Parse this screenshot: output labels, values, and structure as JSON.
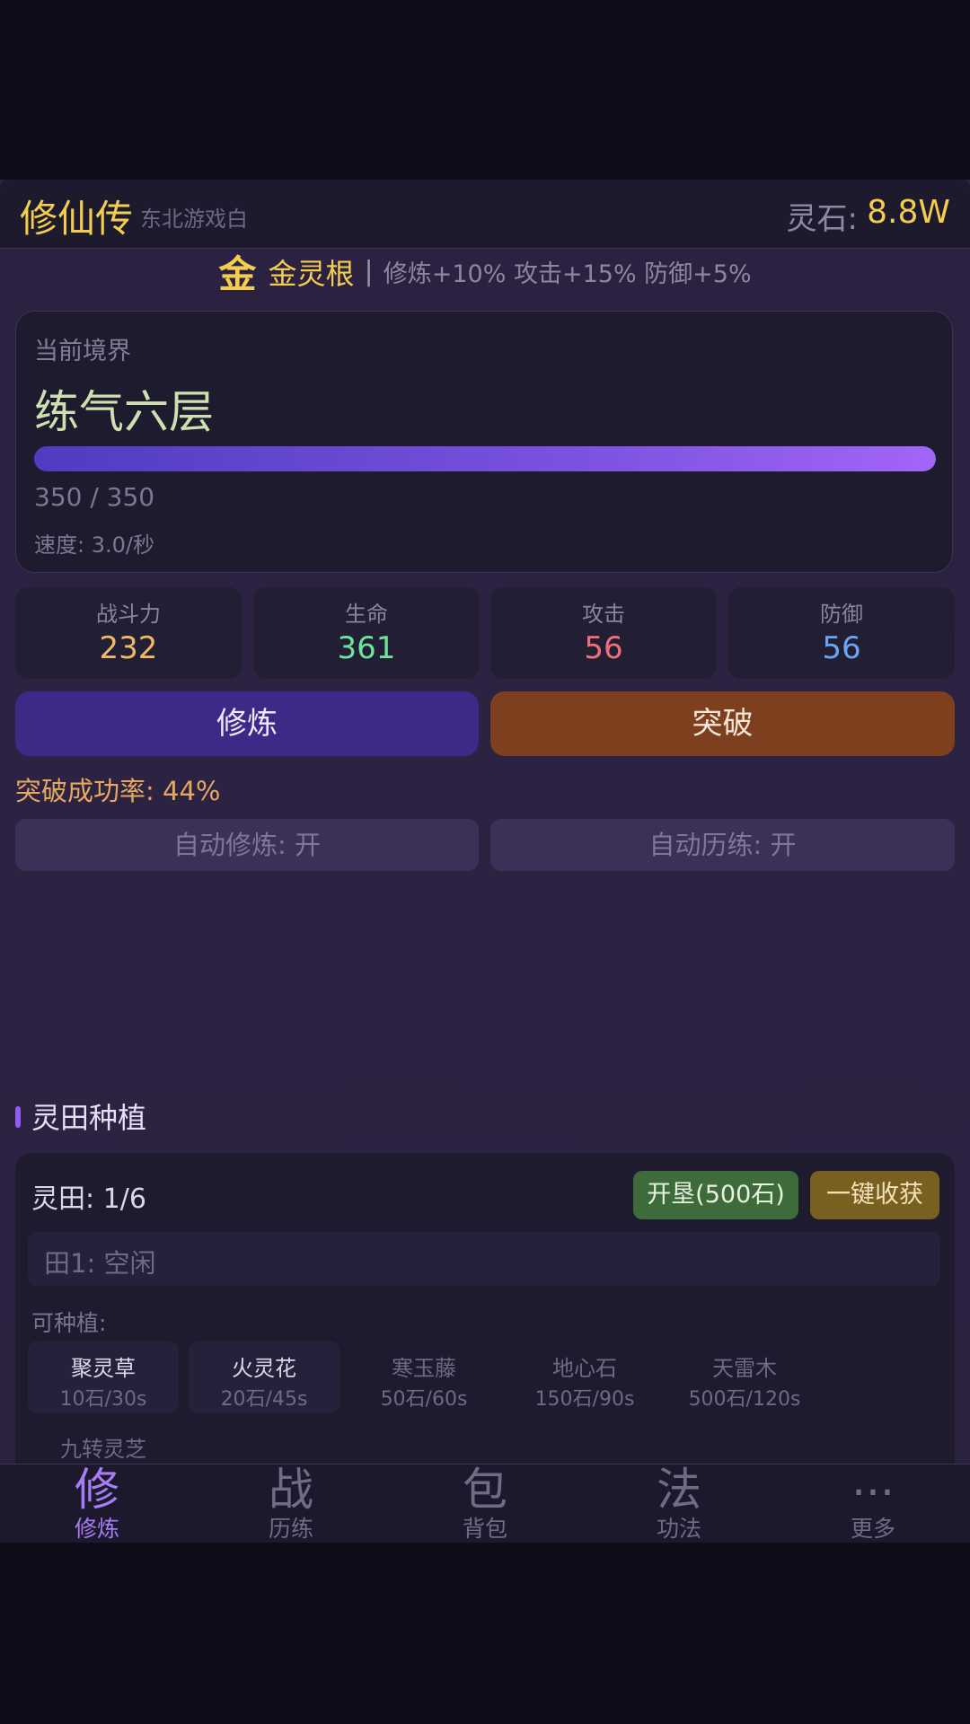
{
  "header": {
    "title": "修仙传",
    "subtitle": "东北游戏白",
    "stone_label": "灵石:",
    "stone_value": "8.8W"
  },
  "root": {
    "glyph": "金",
    "name": "金灵根",
    "separator": "|",
    "bonus": "修炼+10% 攻击+15% 防御+5%"
  },
  "realm": {
    "label": "当前境界",
    "name": "练气六层",
    "progress": "350 / 350",
    "progress_fraction": 1.0,
    "speed": "速度: 3.0/秒"
  },
  "stats": [
    {
      "label": "战斗力",
      "value": "232",
      "color": "#f0b96a"
    },
    {
      "label": "生命",
      "value": "361",
      "color": "#6fe39b"
    },
    {
      "label": "攻击",
      "value": "56",
      "color": "#f0707a"
    },
    {
      "label": "防御",
      "value": "56",
      "color": "#6aa6f5"
    }
  ],
  "actions": {
    "cultivate": "修炼",
    "breakthrough": "突破",
    "success_rate": "突破成功率: 44%",
    "auto_cultivate": "自动修炼: 开",
    "auto_train": "自动历练: 开"
  },
  "farm": {
    "section_title": "灵田种植",
    "count": "灵田: 1/6",
    "reclaim_button": "开垦(500石)",
    "harvest_button": "一键收获",
    "plots": [
      "田1: 空闲"
    ],
    "plantable_label": "可种植:",
    "seeds": [
      {
        "name": "聚灵草",
        "cost": "10石/30s",
        "available": true
      },
      {
        "name": "火灵花",
        "cost": "20石/45s",
        "available": true
      },
      {
        "name": "寒玉藤",
        "cost": "50石/60s",
        "available": false
      },
      {
        "name": "地心石",
        "cost": "150石/90s",
        "available": false
      },
      {
        "name": "天雷木",
        "cost": "500石/120s",
        "available": false
      },
      {
        "name": "九转灵芝",
        "cost": "",
        "available": false
      }
    ]
  },
  "nav": [
    {
      "glyph": "修",
      "label": "修炼",
      "active": true
    },
    {
      "glyph": "战",
      "label": "历练",
      "active": false
    },
    {
      "glyph": "包",
      "label": "背包",
      "active": false
    },
    {
      "glyph": "法",
      "label": "功法",
      "active": false
    },
    {
      "glyph": "...",
      "label": "更多",
      "active": false
    }
  ]
}
